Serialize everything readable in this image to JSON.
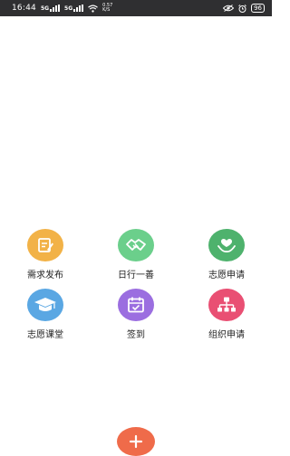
{
  "status_bar": {
    "time": "16:44",
    "signal1": "5G",
    "signal2": "5G",
    "net_speed_value": "0.57",
    "net_speed_unit": "K/S",
    "battery": "96"
  },
  "grid": {
    "items": [
      {
        "label": "需求发布",
        "icon": "edit-note-icon",
        "color": "#f2b247"
      },
      {
        "label": "日行一善",
        "icon": "handshake-icon",
        "color": "#6bcf8b"
      },
      {
        "label": "志愿申请",
        "icon": "heart-hands-icon",
        "color": "#4eb26d"
      },
      {
        "label": "志愿课堂",
        "icon": "graduation-cap-icon",
        "color": "#5aa7e3"
      },
      {
        "label": "签到",
        "icon": "calendar-check-icon",
        "color": "#9b6ee0"
      },
      {
        "label": "组织申请",
        "icon": "org-chart-icon",
        "color": "#e94f73"
      }
    ]
  },
  "fab": {
    "icon": "plus-icon",
    "color": "#ef6b4a"
  }
}
